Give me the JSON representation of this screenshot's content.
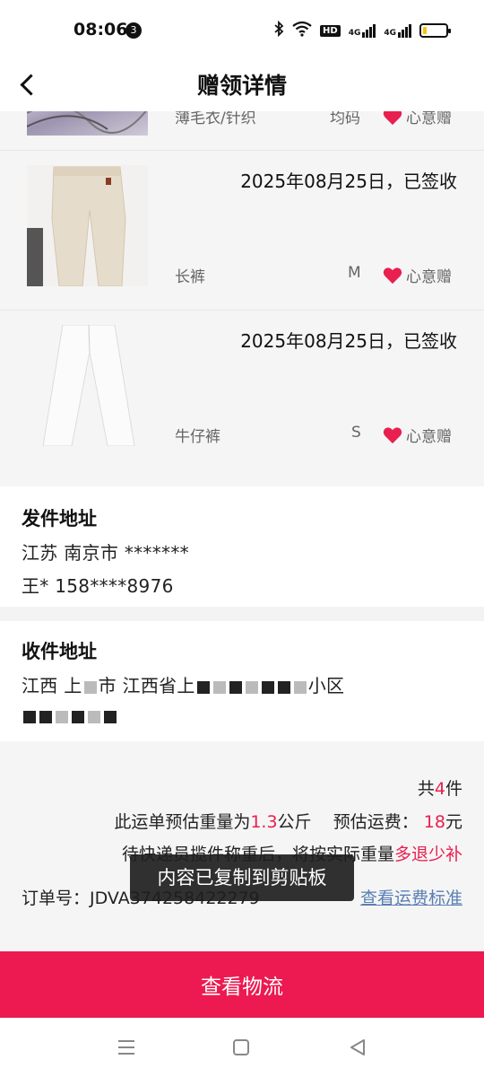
{
  "status_bar": {
    "time": "08:06",
    "notification_count": "3",
    "hd_label": "HD",
    "signal1_label": "4G",
    "signal2_label": "4G",
    "battery_level": 0.15
  },
  "header": {
    "title": "赠领详情"
  },
  "items": [
    {
      "date": "",
      "name": "薄毛衣/针织",
      "size": "均码",
      "tag": "心意赠"
    },
    {
      "date": "2025年08月25日，已签收",
      "name": "长裤",
      "size": "M",
      "tag": "心意赠"
    },
    {
      "date": "2025年08月25日，已签收",
      "name": "牛仔裤",
      "size": "S",
      "tag": "心意赠"
    }
  ],
  "sender": {
    "title": "发件地址",
    "address": "江苏 南京市 *******",
    "contact": "王* 158****8976"
  },
  "receiver": {
    "title": "收件地址",
    "address_visible_1": "江西 上",
    "address_visible_2": "市 江西省上",
    "address_visible_3": "小区"
  },
  "summary": {
    "count_prefix": "共",
    "count": "4",
    "count_suffix": "件",
    "weight_prefix": "此运单预估重量为",
    "weight": "1.3",
    "weight_unit": "公斤",
    "fee_prefix": "预估运费：",
    "fee": "18",
    "fee_unit": "元",
    "note_prefix": "待快递员揽件称重后，将按实际重量",
    "note_highlight": "多退少补",
    "order_label": "订单号：",
    "order_number": "JDVA374258422279",
    "fee_link": "查看运费标准"
  },
  "toast": "内容已复制到剪贴板",
  "button": {
    "label": "查看物流"
  },
  "colors": {
    "accent": "#ec1a50",
    "link": "#5a7eb5"
  }
}
